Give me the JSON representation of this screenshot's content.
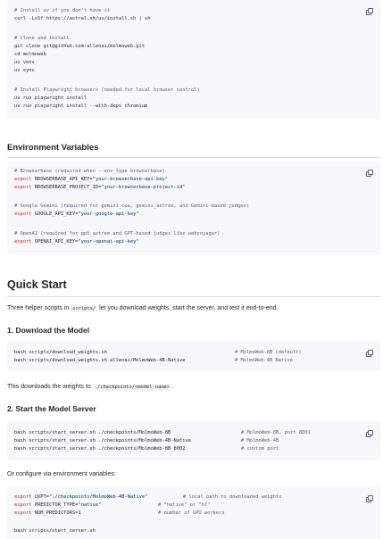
{
  "install_block": {
    "lines": [
      "# Install uv if you don't have it",
      "curl -LsSf https://astral.sh/uv/install.sh | sh",
      "",
      "# Clone and install",
      "git clone git@github.com:allenai/molmoweb.git",
      "cd molmoweb",
      "uv venv",
      "uv sync",
      "",
      "# Install Playwright browsers (needed for local browser control)",
      "uv run playwright install",
      "uv run playwright install --with-deps chromium"
    ]
  },
  "env_section": {
    "heading": "Environment Variables",
    "lines": {
      "c1": "# Browserbase (required when --env_type browserbase)",
      "l1_kw": "export",
      "l1_var": " BROWSERBASE_API_KEY=",
      "l1_val": "\"your-browserbase-api-key\"",
      "l2_kw": "export",
      "l2_var": " BROWSERBASE_PROJECT_ID=",
      "l2_val": "\"your-browserbase-project-id\"",
      "c2": "# Google Gemini (required for gemini_cua, gemini_axtree, and Gemini-based judges)",
      "l3_kw": "export",
      "l3_var": " GOOGLE_API_KEY=",
      "l3_val": "\"your-google-api-key\"",
      "c3": "# OpenAI (required for gpt_axtree and GPT-based judges like webvoyager)",
      "l4_kw": "export",
      "l4_var": " OPENAI_API_KEY=",
      "l4_val": "\"your-openai-api-key\""
    }
  },
  "quick_start": {
    "heading": "Quick Start",
    "intro_pre": "Three helper scripts in ",
    "intro_code": "scripts/",
    "intro_post": " let you download weights, start the server, and test it end-to-end."
  },
  "download": {
    "heading": "1. Download the Model",
    "l1": "bash scripts/download_weights.sh",
    "l1_c": "# MolmoWeb-8B (default)",
    "l2": "bash scripts/download_weights.sh allenai/MolmoWeb-4B-Native",
    "l2_c": "# MolmoWeb-4B Native",
    "note_pre": "This downloads the weights to ",
    "note_code": "./checkpoints/<model-name>",
    "note_post": "."
  },
  "server": {
    "heading": "2. Start the Model Server",
    "l1": "bash scripts/start_server.sh ./checkpoints/MolmoWeb-8B",
    "l1_c": "# MolmoWeb-8B, port 8001",
    "l2": "bash scripts/start_server.sh ./checkpoints/MolmoWeb-4B-Native",
    "l2_c": "# MolmoWeb-4B",
    "l3": "bash scripts/start_server.sh ./checkpoints/MolmoWeb-8B 8002",
    "l3_c": "# custom port",
    "note": "Or configure via environment variables:"
  },
  "env_config": {
    "l1_kw": "export",
    "l1_var": " CKPT=",
    "l1_val": "\"./checkpoints/MolmoWeb-4B-Native\"",
    "l1_c": "# local path to downloaded weights",
    "l2_kw": "export",
    "l2_var": " PREDICTOR_TYPE=",
    "l2_val": "\"native\"",
    "l2_c": "# \"native\" or \"hf\"",
    "l3_kw": "export",
    "l3_var": " NUM_PREDICTORS=1",
    "l3_c": "# number of GPU workers",
    "l4": "bash scripts/start_server.sh"
  }
}
